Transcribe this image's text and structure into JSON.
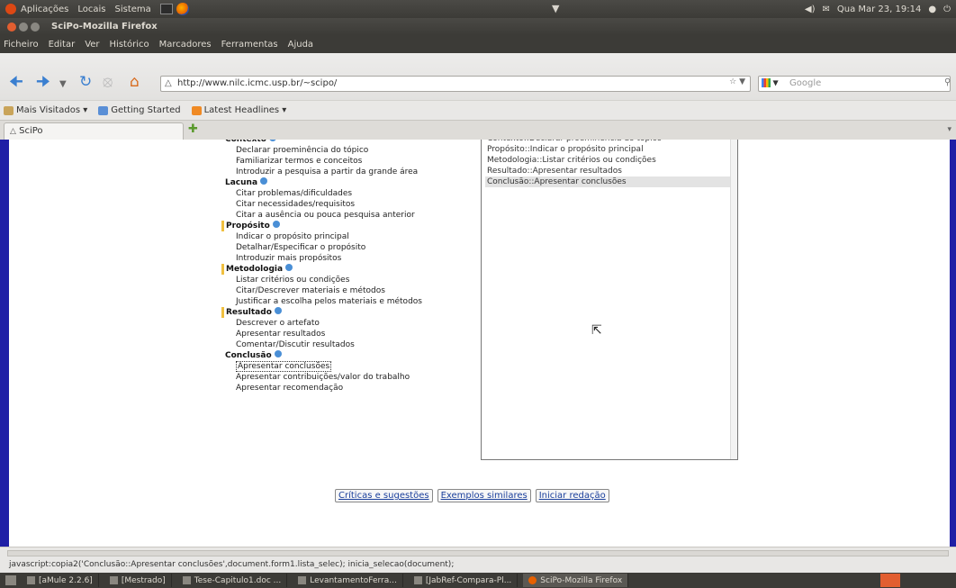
{
  "top_panel": {
    "menus": [
      "Aplicações",
      "Locais",
      "Sistema"
    ],
    "clock": "Qua Mar 23, 19:14",
    "tray_icons": [
      "volume-icon",
      "mail-icon",
      "network-icon",
      "power-icon"
    ]
  },
  "window": {
    "title": "SciPo-Mozilla Firefox"
  },
  "menu_bar": {
    "items": [
      "Ficheiro",
      "Editar",
      "Ver",
      "Histórico",
      "Marcadores",
      "Ferramentas",
      "Ajuda"
    ]
  },
  "navigation": {
    "url": "http://www.nilc.icmc.usp.br/~scipo/",
    "search_placeholder": "Google"
  },
  "bookmarks": {
    "items": [
      "Mais Visitados",
      "Getting Started",
      "Latest Headlines"
    ]
  },
  "tabs": [
    {
      "label": "SciPo"
    }
  ],
  "tree": {
    "sections": [
      {
        "label": "Contexto",
        "marked": false,
        "items": [
          "Declarar proeminência do tópico",
          "Familiarizar termos e conceitos",
          "Introduzir a pesquisa a partir da grande área"
        ]
      },
      {
        "label": "Lacuna",
        "marked": false,
        "items": [
          "Citar problemas/dificuldades",
          "Citar necessidades/requisitos",
          "Citar a ausência ou pouca pesquisa anterior"
        ]
      },
      {
        "label": "Propósito",
        "marked": true,
        "items": [
          "Indicar o propósito principal",
          "Detalhar/Especificar o propósito",
          "Introduzir mais propósitos"
        ]
      },
      {
        "label": "Metodologia",
        "marked": true,
        "items": [
          "Listar critérios ou condições",
          "Citar/Descrever materiais e métodos",
          "Justificar a escolha pelos materiais e métodos"
        ]
      },
      {
        "label": "Resultado",
        "marked": true,
        "items": [
          "Descrever o artefato",
          "Apresentar resultados",
          "Comentar/Discutir resultados"
        ]
      },
      {
        "label": "Conclusão",
        "marked": false,
        "items": [
          "Apresentar conclusões",
          "Apresentar contribuições/valor do trabalho",
          "Apresentar recomendação"
        ]
      }
    ],
    "selected_item": "Apresentar conclusões"
  },
  "selection_list": {
    "items": [
      "Contexto::Declarar proeminência do tópico",
      "Propósito::Indicar o propósito principal",
      "Metodologia::Listar critérios ou condições",
      "Resultado::Apresentar resultados",
      "Conclusão::Apresentar conclusões"
    ],
    "selected_index": 4
  },
  "actions": {
    "criticas": "Críticas e sugestões",
    "exemplos": "Exemplos similares",
    "iniciar": "Iniciar redação"
  },
  "status": {
    "text": "javascript:copia2('Conclusão::Apresentar conclusões',document.form1.lista_selec); inicia_selecao(document);"
  },
  "taskbar": {
    "items": [
      "[aMule 2.2.6]",
      "[Mestrado]",
      "Tese-Capitulo1.doc ...",
      "LevantamentoFerra...",
      "[JabRef-Compara-Pl...",
      "SciPo-Mozilla Firefox"
    ],
    "active_index": 5
  }
}
